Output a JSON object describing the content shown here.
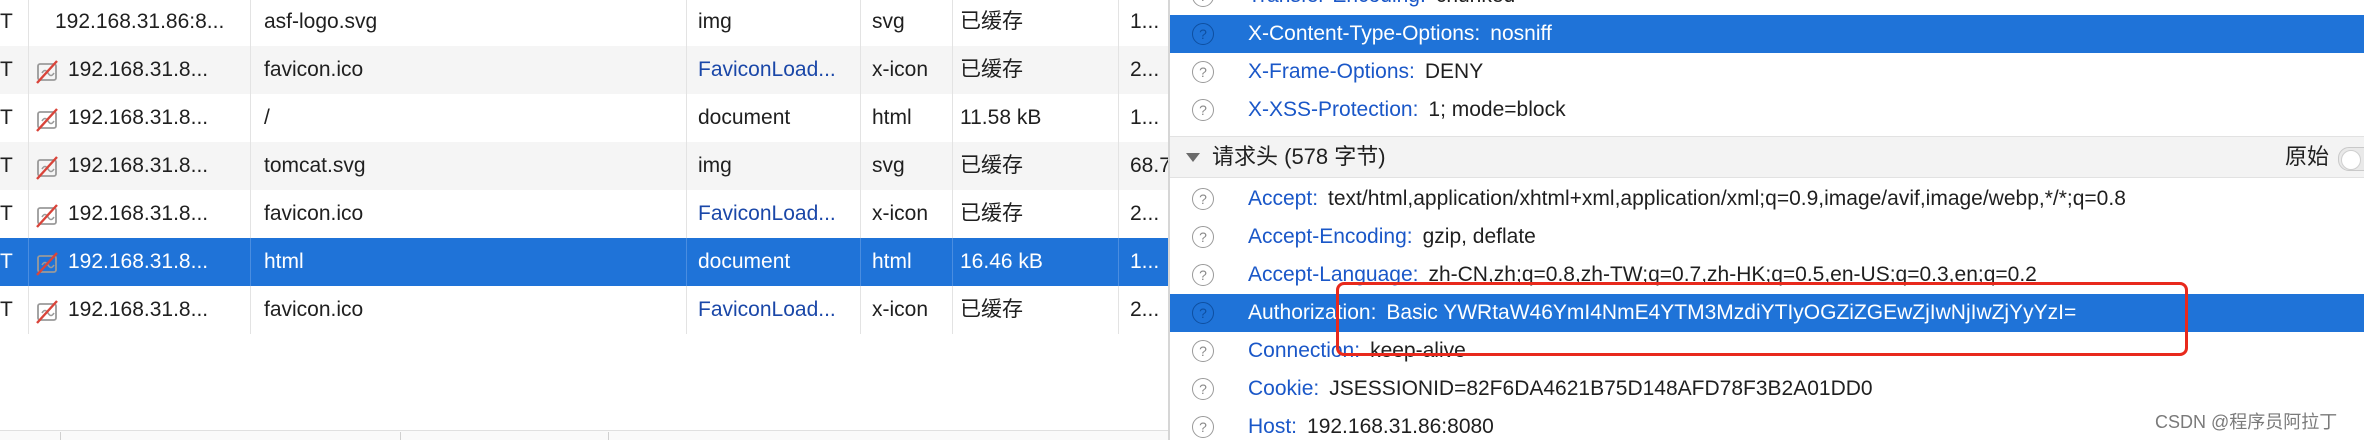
{
  "requests": [
    {
      "method": "T",
      "domain": "192.168.31.86:8...",
      "file": "asf-logo.svg",
      "initiator": "img",
      "initiator_link": false,
      "type": "svg",
      "transferred": "已缓存",
      "size": "1...",
      "no_cache_icon": false
    },
    {
      "method": "T",
      "domain": "192.168.31.8...",
      "file": "favicon.ico",
      "initiator": "FaviconLoad...",
      "initiator_link": true,
      "type": "x-icon",
      "transferred": "已缓存",
      "size": "2...",
      "no_cache_icon": true
    },
    {
      "method": "T",
      "domain": "192.168.31.8...",
      "file": "/",
      "initiator": "document",
      "initiator_link": false,
      "type": "html",
      "transferred": "11.58 kB",
      "size": "1...",
      "no_cache_icon": true
    },
    {
      "method": "T",
      "domain": "192.168.31.8...",
      "file": "tomcat.svg",
      "initiator": "img",
      "initiator_link": false,
      "type": "svg",
      "transferred": "已缓存",
      "size": "68.7",
      "no_cache_icon": true
    },
    {
      "method": "T",
      "domain": "192.168.31.8...",
      "file": "favicon.ico",
      "initiator": "FaviconLoad...",
      "initiator_link": true,
      "type": "x-icon",
      "transferred": "已缓存",
      "size": "2...",
      "no_cache_icon": true
    },
    {
      "method": "T",
      "domain": "192.168.31.8...",
      "file": "html",
      "initiator": "document",
      "initiator_link": false,
      "type": "html",
      "transferred": "16.46 kB",
      "size": "1...",
      "no_cache_icon": true,
      "selected": true
    },
    {
      "method": "T",
      "domain": "192.168.31.8...",
      "file": "favicon.ico",
      "initiator": "FaviconLoad...",
      "initiator_link": true,
      "type": "x-icon",
      "transferred": "已缓存",
      "size": "2...",
      "no_cache_icon": true
    }
  ],
  "response_headers": [
    {
      "name": "Transfer-Encoding:",
      "value": "chunked"
    },
    {
      "name": "X-Content-Type-Options:",
      "value": "nosniff",
      "selected": true
    },
    {
      "name": "X-Frame-Options:",
      "value": "DENY"
    },
    {
      "name": "X-XSS-Protection:",
      "value": "1; mode=block"
    }
  ],
  "request_section": {
    "title": "请求头 (578 字节)",
    "raw_label": "原始",
    "raw_enabled": false
  },
  "request_headers": [
    {
      "name": "Accept:",
      "value": "text/html,application/xhtml+xml,application/xml;q=0.9,image/avif,image/webp,*/*;q=0.8"
    },
    {
      "name": "Accept-Encoding:",
      "value": "gzip, deflate"
    },
    {
      "name": "Accept-Language:",
      "value": "zh-CN,zh;q=0.8,zh-TW;q=0.7,zh-HK;q=0.5,en-US;q=0.3,en;q=0.2"
    },
    {
      "name": "Authorization:",
      "value": "Basic YWRtaW46YmI4NmE4YTM3MzdiYTIyOGZiZGEwZjIwNjIwZjYyYzI=",
      "selected": true
    },
    {
      "name": "Connection:",
      "value": "keep-alive"
    },
    {
      "name": "Cookie:",
      "value": "JSESSIONID=82F6DA4621B75D148AFD78F3B2A01DD0"
    },
    {
      "name": "Host:",
      "value": "192.168.31.86:8080"
    }
  ],
  "info_icon": "?",
  "watermark": "CSDN @程序员阿拉丁",
  "colors": {
    "selection": "#1f73d8",
    "header_name": "#1a57c8",
    "annotation": "#e8291c"
  }
}
